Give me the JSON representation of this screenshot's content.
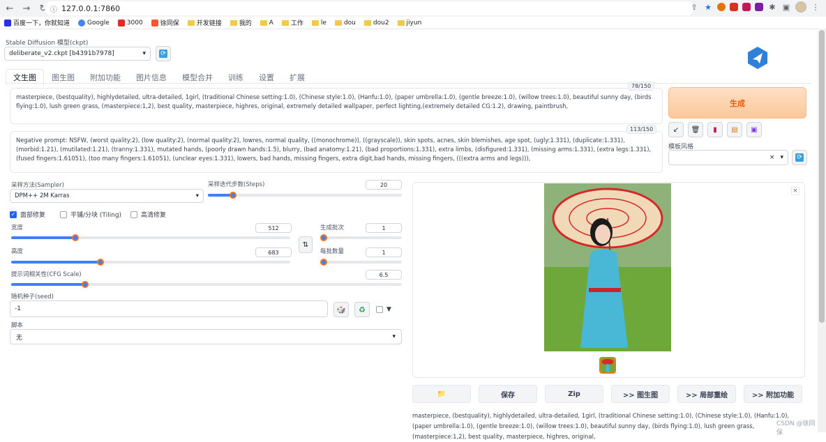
{
  "browser": {
    "url": "127.0.0.1:7860",
    "bookmarks": [
      "百度一下，你就知道",
      "Google",
      "3000",
      "徐同保",
      "开发链接",
      "我的",
      "A",
      "工作",
      "le",
      "dou",
      "dou2",
      "jiyun"
    ]
  },
  "header": {
    "model_label": "Stable Diffusion 模型(ckpt)",
    "model_value": "deliberate_v2.ckpt [b4391b7978]"
  },
  "tabs": [
    "文生图",
    "图生图",
    "附加功能",
    "图片信息",
    "模型合并",
    "训练",
    "设置",
    "扩展"
  ],
  "prompt": {
    "text": "masterpiece, (bestquality), highlydetailed, ultra-detailed, 1girl, (traditional Chinese setting:1.0), (Chinese style:1.0), (Hanfu:1.0), (paper umbrella:1.0), (gentle breeze:1.0), (willow trees:1.0), beautiful sunny day, (birds flying:1.0), lush green grass, (masterpiece:1,2), best quality, masterpiece, highres, original, extremely detailed wallpaper, perfect lighting,(extremely detailed CG:1.2), drawing, paintbrush,",
    "counter": "78/150"
  },
  "negative": {
    "text": "Negative prompt: NSFW, (worst quality:2), (low quality:2), (normal quality:2), lowres, normal quality, ((monochrome)), ((grayscale)), skin spots, acnes, skin blemishes, age spot, (ugly:1.331), (duplicate:1.331), (morbid:1.21), (mutilated:1.21), (tranny:1.331), mutated hands, (poorly drawn hands:1.5), blurry, (bad anatomy:1.21), (bad proportions:1.331), extra limbs, (disfigured:1.331), (missing arms:1.331), (extra legs:1.331), (fused fingers:1.61051), (too many fingers:1.61051), (unclear eyes:1.331), lowers, bad hands, missing fingers, extra digit,bad hands, missing fingers, (((extra arms and legs))),",
    "counter": "113/150"
  },
  "generate_label": "生成",
  "style": {
    "label": "模板风格",
    "clear": "×"
  },
  "sampler": {
    "label": "采样方法(Sampler)",
    "value": "DPM++ 2M Karras"
  },
  "steps": {
    "label": "采样迭代步数(Steps)",
    "value": "20",
    "fraction": 0.13
  },
  "checkboxes": {
    "face_restore": "面部修复",
    "tiling": "平铺/分块 (Tiling)",
    "hires": "高清修复"
  },
  "width": {
    "label": "宽度",
    "value": "512",
    "fraction": 0.23
  },
  "height": {
    "label": "高度",
    "value": "683",
    "fraction": 0.32
  },
  "batch_count": {
    "label": "生成批次",
    "value": "1",
    "fraction": 0.0
  },
  "batch_size": {
    "label": "每批数量",
    "value": "1",
    "fraction": 0.0
  },
  "cfg": {
    "label": "提示词相关性(CFG Scale)",
    "value": "6.5",
    "fraction": 0.19
  },
  "seed": {
    "label": "随机种子(seed)",
    "value": "-1"
  },
  "script": {
    "label": "脚本",
    "value": "无"
  },
  "actions": [
    "📁",
    "保存",
    "Zip",
    ">> 图生图",
    ">> 局部重绘",
    ">> 附加功能"
  ],
  "output_info": "masterpiece, (bestquality), highlydetailed, ultra-detailed, 1girl, (traditional Chinese setting:1.0), (Chinese style:1.0), (Hanfu:1.0), (paper umbrella:1.0), (gentle breeze:1.0), (willow trees:1.0), beautiful sunny day, (birds flying:1.0), lush green grass,(masterpiece:1,2), best quality, masterpiece, highres, original,",
  "watermark": "CSDN @徐同保",
  "colors": {
    "accent": "#3b82f6",
    "generate": "#ea580c"
  }
}
